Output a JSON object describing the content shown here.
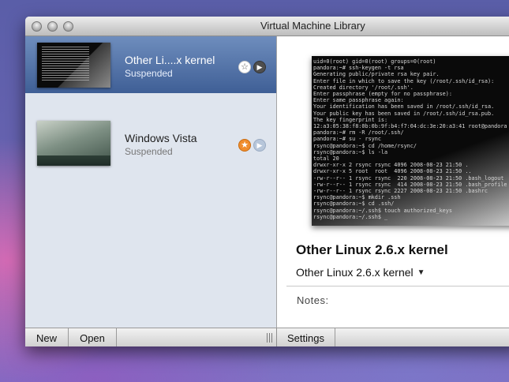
{
  "window": {
    "title": "Virtual Machine Library"
  },
  "library": {
    "items": [
      {
        "name": "Other Li....x kernel",
        "status": "Suspended",
        "favorite": false,
        "selected": true,
        "favorite_icon": "star-outline-icon",
        "play_icon": "play-icon"
      },
      {
        "name": "Windows Vista",
        "status": "Suspended",
        "favorite": true,
        "selected": false,
        "favorite_icon": "star-filled-icon",
        "play_icon": "play-icon"
      }
    ]
  },
  "detail": {
    "vm_title": "Other Linux 2.6.x kernel",
    "os_select": "Other Linux 2.6.x kernel",
    "notes_label": "Notes:",
    "terminal_lines": [
      "uid=0(root) gid=0(root) groups=0(root)",
      "pandora:~# ssh-keygen -t rsa",
      "Generating public/private rsa key pair.",
      "Enter file in which to save the key (/root/.ssh/id_rsa):",
      "Created directory '/root/.ssh'.",
      "Enter passphrase (empty for no passphrase):",
      "Enter same passphrase again:",
      "Your identification has been saved in /root/.ssh/id_rsa.",
      "Your public key has been saved in /root/.ssh/id_rsa.pub.",
      "The key fingerprint is:",
      "12:a3:05:38:f8:0b:0b:9f:b4:f7:04:dc:3e:20:a3:41 root@pandora",
      "pandora:~# rm -R /root/.ssh/",
      "pandora:~# su - rsync",
      "rsync@pandora:~$ cd /home/rsync/",
      "rsync@pandora:~$ ls -la",
      "total 20",
      "drwxr-xr-x 2 rsync rsync 4096 2008-08-23 21:50 .",
      "drwxr-xr-x 5 root  root  4096 2008-08-23 21:50 ..",
      "-rw-r--r-- 1 rsync rsync  220 2008-08-23 21:50 .bash_logout",
      "-rw-r--r-- 1 rsync rsync  414 2008-08-23 21:50 .bash_profile",
      "-rw-r--r-- 1 rsync rsync 2227 2008-08-23 21:50 .bashrc",
      "rsync@pandora:~$ mkdir .ssh",
      "rsync@pandora:~$ cd .ssh/",
      "rsync@pandora:~/.ssh$ touch authorized_keys",
      "rsync@pandora:~/.ssh$ _"
    ]
  },
  "bottombar": {
    "new_label": "New",
    "open_label": "Open",
    "settings_label": "Settings"
  },
  "colors": {
    "selection": "#4f6fa6",
    "favorite": "#f08d2d"
  }
}
